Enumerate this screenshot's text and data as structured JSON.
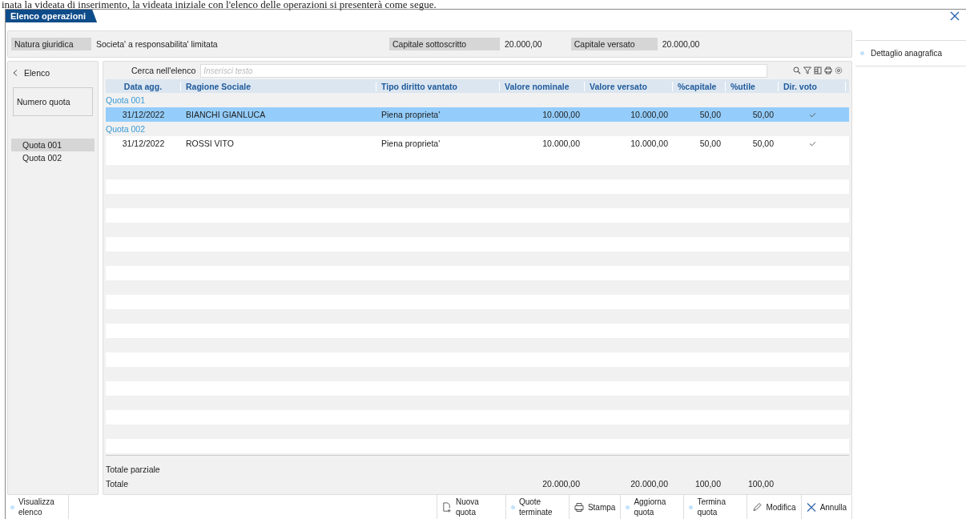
{
  "caption": "inata la videata di inserimento, la videata iniziale con l'elenco delle operazioni si presenterà come segue.",
  "window": {
    "title": "Elenco operazioni"
  },
  "info": [
    {
      "label": "Natura giuridica",
      "value": "Societa' a responsabilita' limitata"
    },
    {
      "label": "Capitale sottoscritto",
      "value": "20.000,00"
    },
    {
      "label": "Capitale versato",
      "value": "20.000,00"
    }
  ],
  "right_panel": {
    "items": [
      "Dettaglio anagrafica"
    ]
  },
  "left_panel": {
    "title": "Elenco",
    "filter_label": "Numero quota",
    "items": [
      {
        "label": "Quota 001",
        "selected": true
      },
      {
        "label": "Quota 002",
        "selected": false
      }
    ]
  },
  "search": {
    "label": "Cerca nell'elenco",
    "placeholder": "Inserisci testo"
  },
  "table": {
    "columns": [
      "Data agg.",
      "Ragione Sociale",
      "Tipo diritto vantato",
      "Valore nominale",
      "Valore versato",
      "%capitale",
      "%utile",
      "Dir. voto"
    ],
    "groups": [
      {
        "title": "Quota 001",
        "rows": [
          {
            "cells": [
              "31/12/2022",
              "BIANCHI GIANLUCA",
              "Piena proprieta'",
              "10.000,00",
              "10.000,00",
              "50,00",
              "50,00"
            ],
            "dir_voto": true,
            "selected": true
          }
        ]
      },
      {
        "title": "Quota 002",
        "rows": [
          {
            "cells": [
              "31/12/2022",
              "ROSSI VITO",
              "Piena proprieta'",
              "10.000,00",
              "10.000,00",
              "50,00",
              "50,00"
            ],
            "dir_voto": true,
            "selected": false
          }
        ]
      }
    ],
    "partial_total_label": "Totale parziale",
    "total": {
      "label": "Totale",
      "cells": [
        "20.000,00",
        "20.000,00",
        "100,00",
        "100,00"
      ]
    }
  },
  "toolbar_left": [
    {
      "kind": "dot",
      "label": "Visualizza elenco"
    }
  ],
  "toolbar": [
    {
      "kind": "new",
      "label": "Nuova quota"
    },
    {
      "kind": "dot",
      "label": "Quote terminate"
    },
    {
      "kind": "print",
      "label": "Stampa"
    },
    {
      "kind": "dot",
      "label": "Aggiorna quota"
    },
    {
      "kind": "dot",
      "label": "Termina quota"
    },
    {
      "kind": "edit",
      "label": "Modifica"
    },
    {
      "kind": "cancel",
      "label": "Annulla"
    }
  ]
}
